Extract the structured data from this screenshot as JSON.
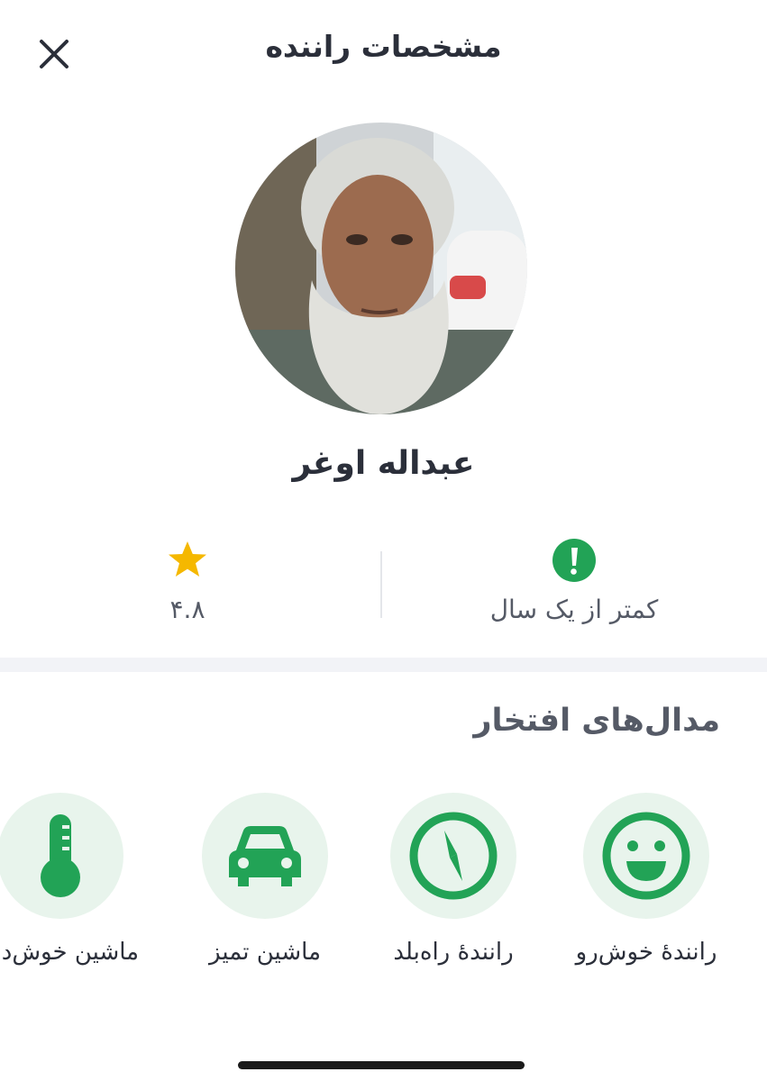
{
  "header": {
    "title": "مشخصات راننده",
    "close_icon": "close-icon"
  },
  "driver": {
    "name": "عبداله اوغر",
    "photo_icon": "driver-photo"
  },
  "stats": {
    "rating": {
      "value": "۴.۸",
      "icon": "star-icon",
      "color": "#f5b800"
    },
    "experience": {
      "label": "کمتر از یک سال",
      "icon": "exclamation-icon",
      "color": "#22a356"
    }
  },
  "medals_section": {
    "title": "مدال‌های افتخار",
    "items": [
      {
        "label": "رانندهٔ خوش‌رو",
        "icon": "smile-icon"
      },
      {
        "label": "رانندهٔ راه‌بلد",
        "icon": "compass-icon"
      },
      {
        "label": "ماشین تمیز",
        "icon": "car-icon"
      },
      {
        "label": "ماشین خوش‌دما",
        "icon": "thermometer-icon"
      }
    ]
  },
  "colors": {
    "accent_green": "#22a356",
    "medal_bg": "#e8f4ec",
    "text_dark": "#2b2f3a",
    "text_muted": "#555a66"
  }
}
